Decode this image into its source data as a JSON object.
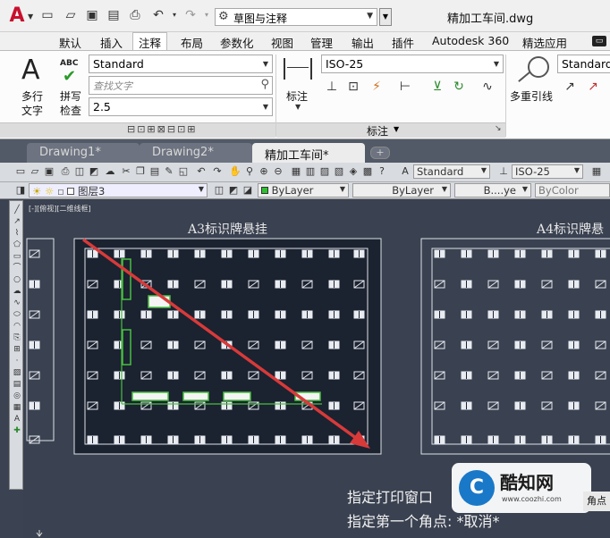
{
  "app": {
    "logo": "A",
    "workspace": "草图与注释",
    "doc_title": "精加工车间.dwg"
  },
  "ribbon_tabs": [
    "默认",
    "插入",
    "注释",
    "布局",
    "参数化",
    "视图",
    "管理",
    "输出",
    "插件",
    "Autodesk 360",
    "精选应用"
  ],
  "ribbon": {
    "text_panel": {
      "mtext_label_1": "多行",
      "mtext_label_2": "文字",
      "spell_check_abc": "ABC",
      "spell_check_label_1": "拼写",
      "spell_check_label_2": "检查",
      "text_style": "Standard",
      "search_placeholder": "查找文字",
      "text_height": "2.5"
    },
    "dim_panel": {
      "dimension_label": "标注",
      "dim_style": "ISO-25",
      "panel_title": "标注"
    },
    "leader_panel": {
      "leader_label": "多重引线",
      "leader_style": "Standard"
    }
  },
  "doc_tabs": [
    {
      "label": "Drawing1*",
      "active": false
    },
    {
      "label": "Drawing2*",
      "active": false
    },
    {
      "label": "精加工车间*",
      "active": true
    }
  ],
  "toolbar1": {
    "text_style": "Standard",
    "dim_style": "ISO-25"
  },
  "toolbar2": {
    "layer_name": "图层3",
    "color": "ByLayer",
    "linetype": "ByLayer",
    "lineweight": "B....ye",
    "plot_style": "ByColor"
  },
  "viewport_label": "[-][俯视][二维线框]",
  "drawing": {
    "sheet_a3_title": "A3标识牌悬挂",
    "sheet_a4_title": "A4标识牌悬"
  },
  "command_line": {
    "line1": "指定打印窗口",
    "line2": "指定第一个角点: *取消*"
  },
  "watermark": {
    "name": "酷知网",
    "url": "www.coozhi.com"
  },
  "edge_button": "角点",
  "colors": {
    "canvas_bg": "#3a4150",
    "sheet_bg": "#1b2230",
    "arrow_red": "#d83a3a",
    "highlight_green": "#48c040"
  }
}
